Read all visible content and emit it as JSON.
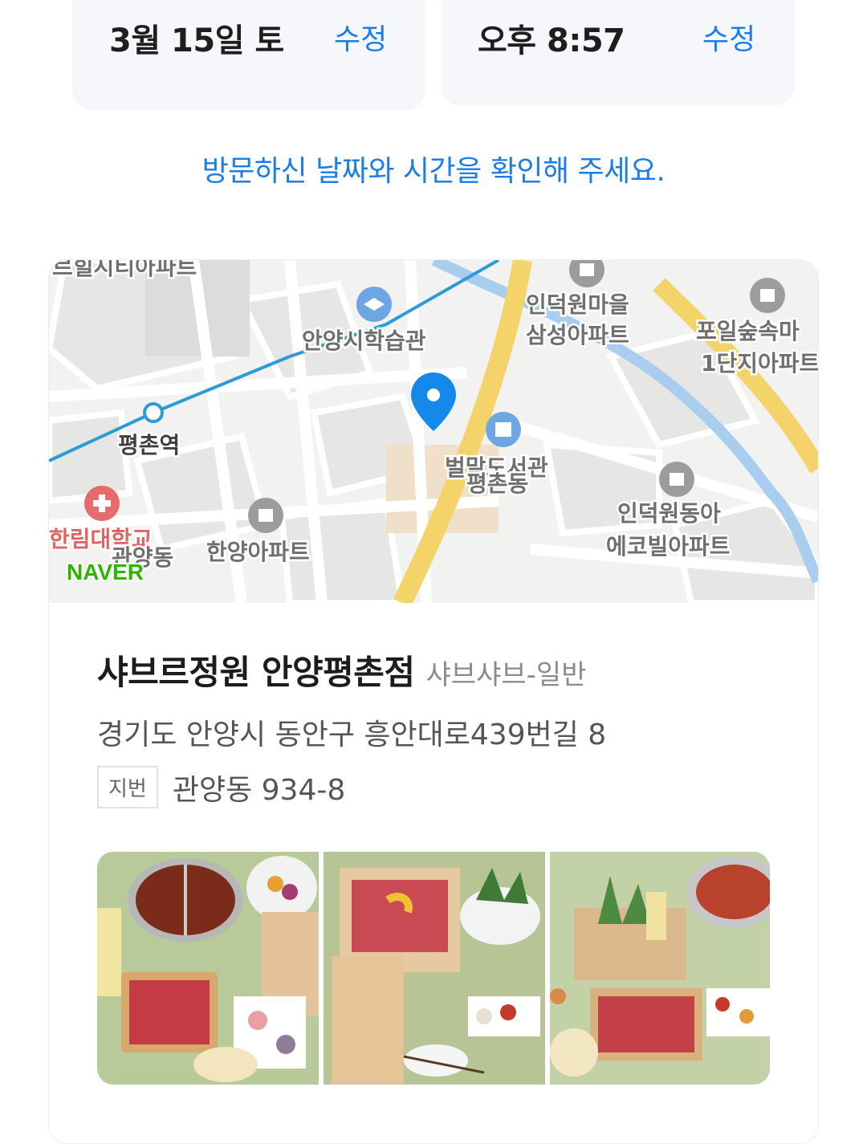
{
  "date": {
    "value": "3월 15일 토",
    "edit_label": "수정"
  },
  "time": {
    "value": "오후 8:57",
    "edit_label": "수정"
  },
  "notice": "방문하신 날짜와 시간을 확인해 주세요.",
  "map": {
    "labels": {
      "top_left": "르힐시티아파트",
      "library_study": "안양시학습관",
      "apt_indeok": "인덕원마을",
      "apt_indeok2": "삼성아파트",
      "apt_poil": "포일숲속마",
      "apt_poil2": "1단지아파트",
      "station": "평촌역",
      "library": "벌말도서관",
      "dong": "평촌동",
      "apt_dongah": "인덕원동아",
      "apt_dongah2": "에코빌아파트",
      "hospital": "한림대학교",
      "apt_hanyang": "한양아파트",
      "dong2": "관양동",
      "provider": "NAVER"
    }
  },
  "place": {
    "name": "샤브르정원 안양평촌점",
    "category": "샤브샤브-일반",
    "address": "경기도 안양시 동안구 흥안대로439번길 8",
    "lot_badge": "지번",
    "lot_address": "관양동 934-8"
  },
  "colors": {
    "accent": "#1a7de8",
    "subway": "#2d9bd6",
    "road": "#f3d36a",
    "pin": "#1489ea"
  },
  "icons": [
    "school-icon",
    "apartment-icon",
    "book-icon",
    "hospital-icon",
    "location-pin-icon",
    "subway-station-icon"
  ]
}
